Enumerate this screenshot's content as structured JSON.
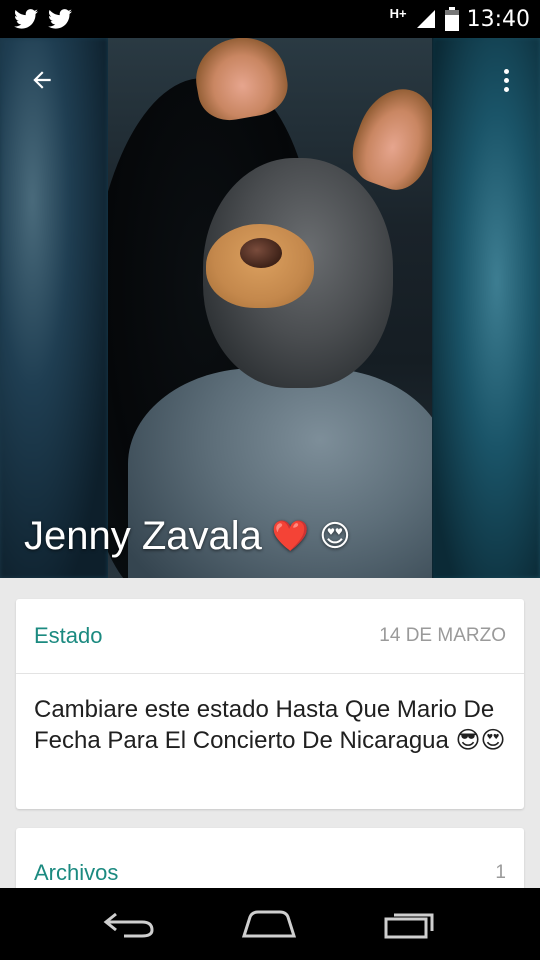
{
  "status_bar": {
    "left_icons": [
      "twitter-icon",
      "twitter-icon"
    ],
    "network": "H+",
    "time": "13:40"
  },
  "header": {
    "back_icon": "arrow-back-icon",
    "menu_icon": "more-vert-icon",
    "profile_name": "Jenny Zavala",
    "name_emojis": [
      "❤️",
      "😍"
    ]
  },
  "status_card": {
    "title": "Estado",
    "date": "14 DE MARZO",
    "text": "Cambiare este estado Hasta Que Mario De Fecha Para El Concierto De Nicaragua 😎😍"
  },
  "files_card": {
    "title": "Archivos",
    "count": "1"
  },
  "nav_bar": {
    "icons": [
      "back-nav-icon",
      "home-nav-icon",
      "recents-nav-icon"
    ]
  },
  "colors": {
    "accent": "#1b8a80",
    "meta_text": "#9a9a9a",
    "background": "#e9e9e9"
  }
}
